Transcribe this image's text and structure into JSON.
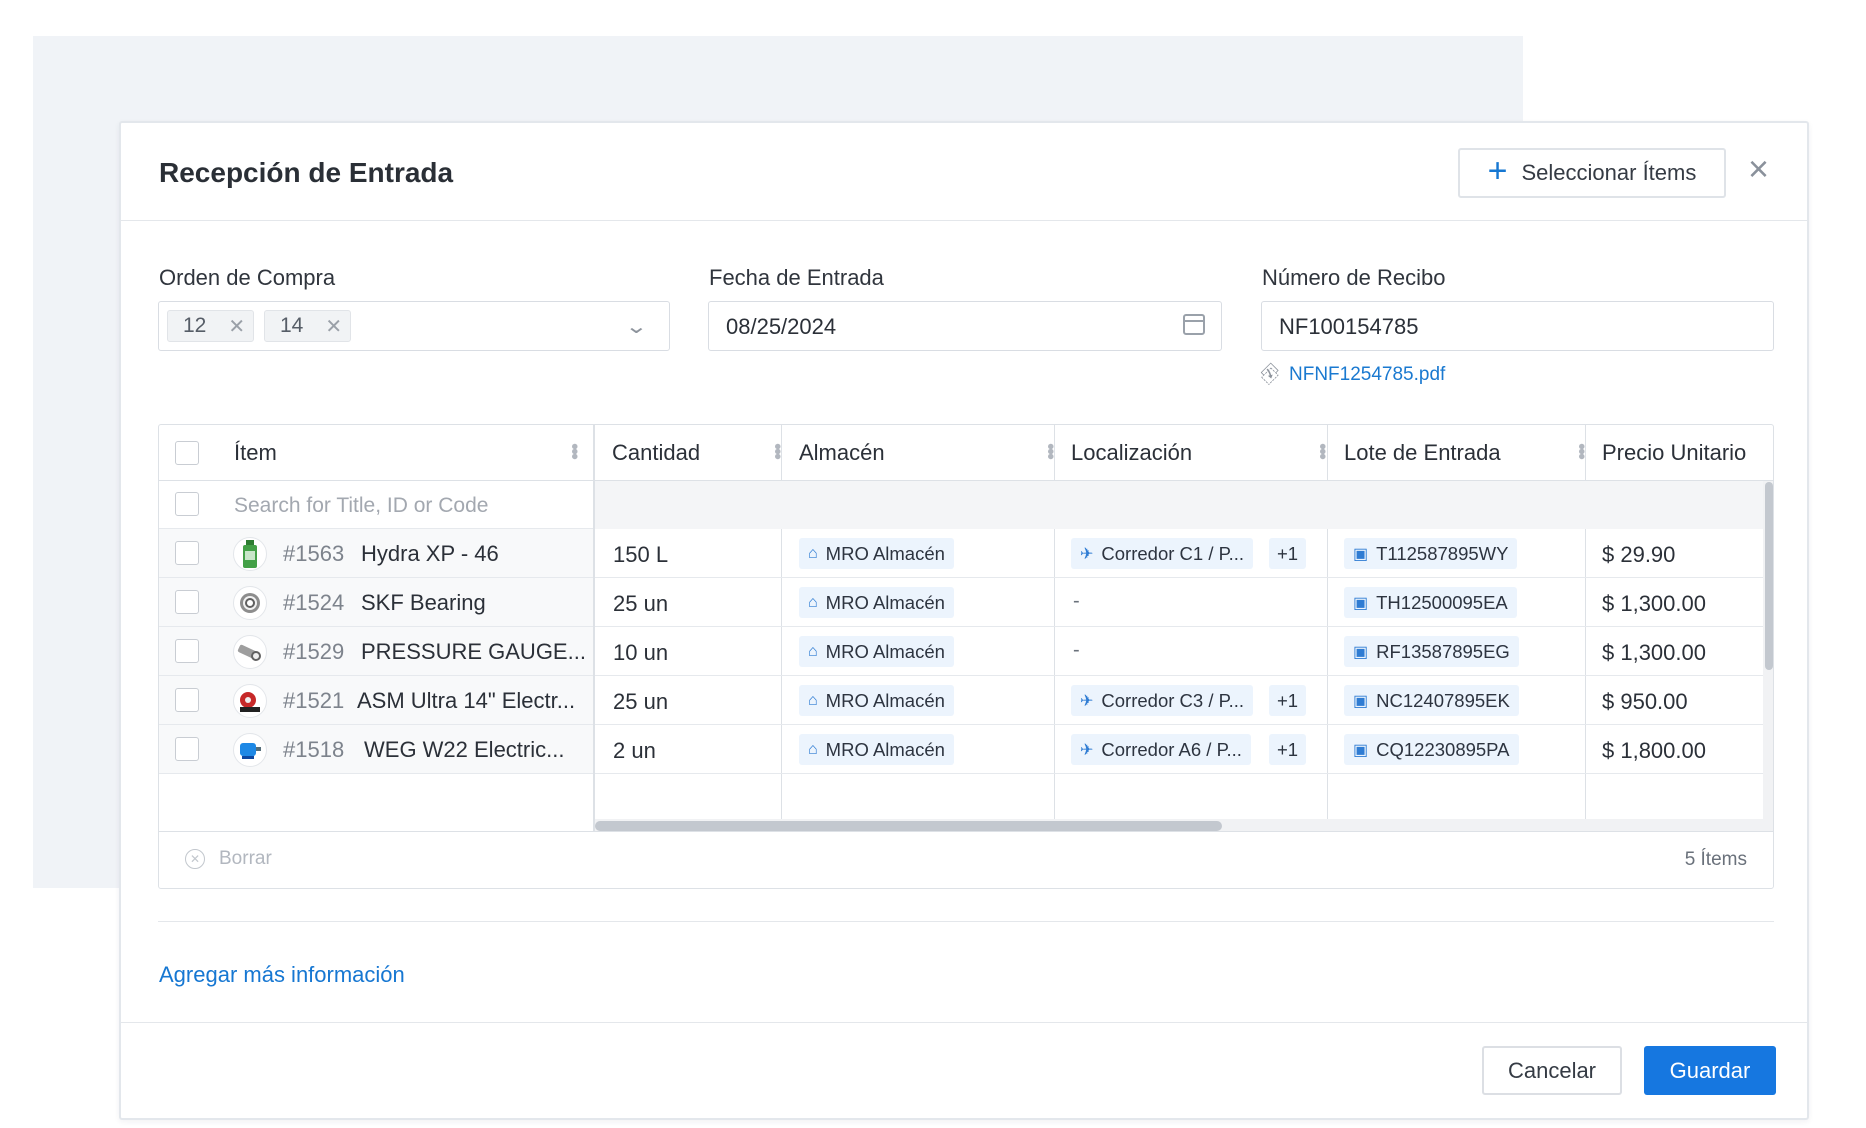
{
  "modal": {
    "title": "Recepción de Entrada",
    "select_items_label": "Seleccionar Ítems",
    "close_label": "×"
  },
  "form": {
    "order": {
      "label": "Orden de Compra",
      "tags": [
        "12",
        "14"
      ]
    },
    "entry_date": {
      "label": "Fecha de Entrada",
      "value": "08/25/2024"
    },
    "receipt": {
      "label": "Número de Recibo",
      "value": "NF100154785",
      "attachment": "NFNF1254785.pdf"
    }
  },
  "table": {
    "columns": [
      "Ítem",
      "Cantidad",
      "Almacén",
      "Localización",
      "Lote de Entrada",
      "Precio Unitario"
    ],
    "search_placeholder": "Search for Title, ID or Code",
    "rows": [
      {
        "id": "#1563",
        "name": "Hydra XP - 46",
        "quantity": "150 L",
        "warehouse": "MRO Almacén",
        "location": "Corredor C1  / P...",
        "location_extra": "+1",
        "lot": "T112587895WY",
        "price": "$ 29.90",
        "thumb": "oil-bottle-icon"
      },
      {
        "id": "#1524",
        "name": "SKF Bearing",
        "quantity": "25 un",
        "warehouse": "MRO Almacén",
        "location": "-",
        "location_extra": "",
        "lot": "TH12500095EA",
        "price": "$ 1,300.00",
        "thumb": "bearing-icon"
      },
      {
        "id": "#1529",
        "name": "PRESSURE GAUGE...",
        "quantity": "10 un",
        "warehouse": "MRO Almacén",
        "location": "-",
        "location_extra": "",
        "lot": "RF13587895EG",
        "price": "$ 1,300.00",
        "thumb": "gauge-icon"
      },
      {
        "id": "#1521",
        "name": "ASM Ultra 14\" Electr...",
        "quantity": "25 un",
        "warehouse": "MRO Almacén",
        "location": "Corredor C3  / P...",
        "location_extra": "+1",
        "lot": "NC12407895EK",
        "price": "$ 950.00",
        "thumb": "saw-icon"
      },
      {
        "id": "#1518",
        "name": "WEG W22 Electric...",
        "quantity": "2 un",
        "warehouse": "MRO Almacén",
        "location": "Corredor A6  / P...",
        "location_extra": "+1",
        "lot": "CQ12230895PA",
        "price": "$ 1,800.00",
        "thumb": "motor-icon"
      }
    ],
    "clear_label": "Borrar",
    "count_label": "5 Ítems"
  },
  "more_info_label": "Agregar más información",
  "footer": {
    "cancel_label": "Cancelar",
    "save_label": "Guardar"
  },
  "colors": {
    "accent": "#1677e0",
    "chip_bg": "#ecf4fd",
    "backdrop": "#f0f3f7"
  }
}
